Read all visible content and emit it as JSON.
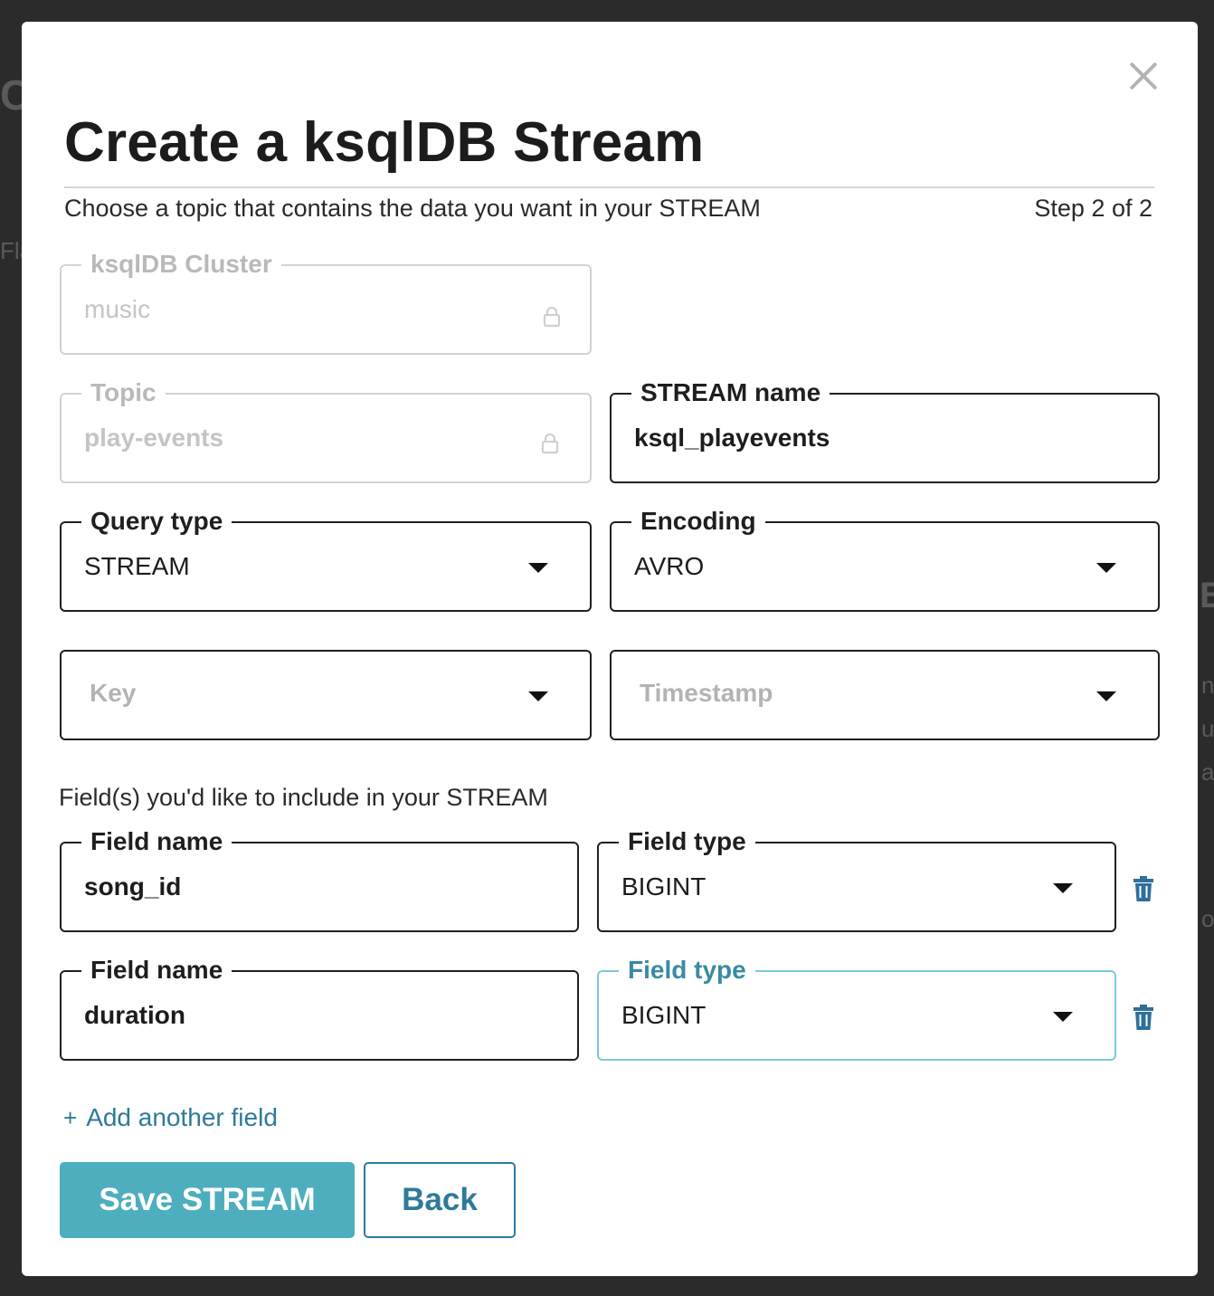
{
  "background": {
    "glyphs": [
      "C",
      "Fla",
      "B",
      "n",
      "u",
      "a",
      "o"
    ]
  },
  "dialog": {
    "title": "Create a ksqlDB Stream",
    "subtitle": "Choose a topic that contains the data you want in your STREAM",
    "step": "Step 2 of 2"
  },
  "form": {
    "cluster": {
      "label": "ksqlDB Cluster",
      "value": "music",
      "locked": true
    },
    "topic": {
      "label": "Topic",
      "value": "play-events",
      "locked": true
    },
    "stream_name": {
      "label": "STREAM name",
      "value": "ksql_playevents"
    },
    "query_type": {
      "label": "Query type",
      "value": "STREAM"
    },
    "encoding": {
      "label": "Encoding",
      "value": "AVRO"
    },
    "key": {
      "placeholder": "Key"
    },
    "timestamp": {
      "placeholder": "Timestamp"
    }
  },
  "fields_section": {
    "label": "Field(s) you'd like to include in your STREAM",
    "fields": [
      {
        "name_label": "Field name",
        "name": "song_id",
        "type_label": "Field type",
        "type": "BIGINT"
      },
      {
        "name_label": "Field name",
        "name": "duration",
        "type_label": "Field type",
        "type": "BIGINT"
      }
    ],
    "add_label": "Add another field"
  },
  "actions": {
    "save": "Save STREAM",
    "back": "Back"
  },
  "colors": {
    "accent": "#4daebe",
    "link": "#2f7a99",
    "focus": "#7fc7dd",
    "overlay": "#2b2b2b"
  }
}
